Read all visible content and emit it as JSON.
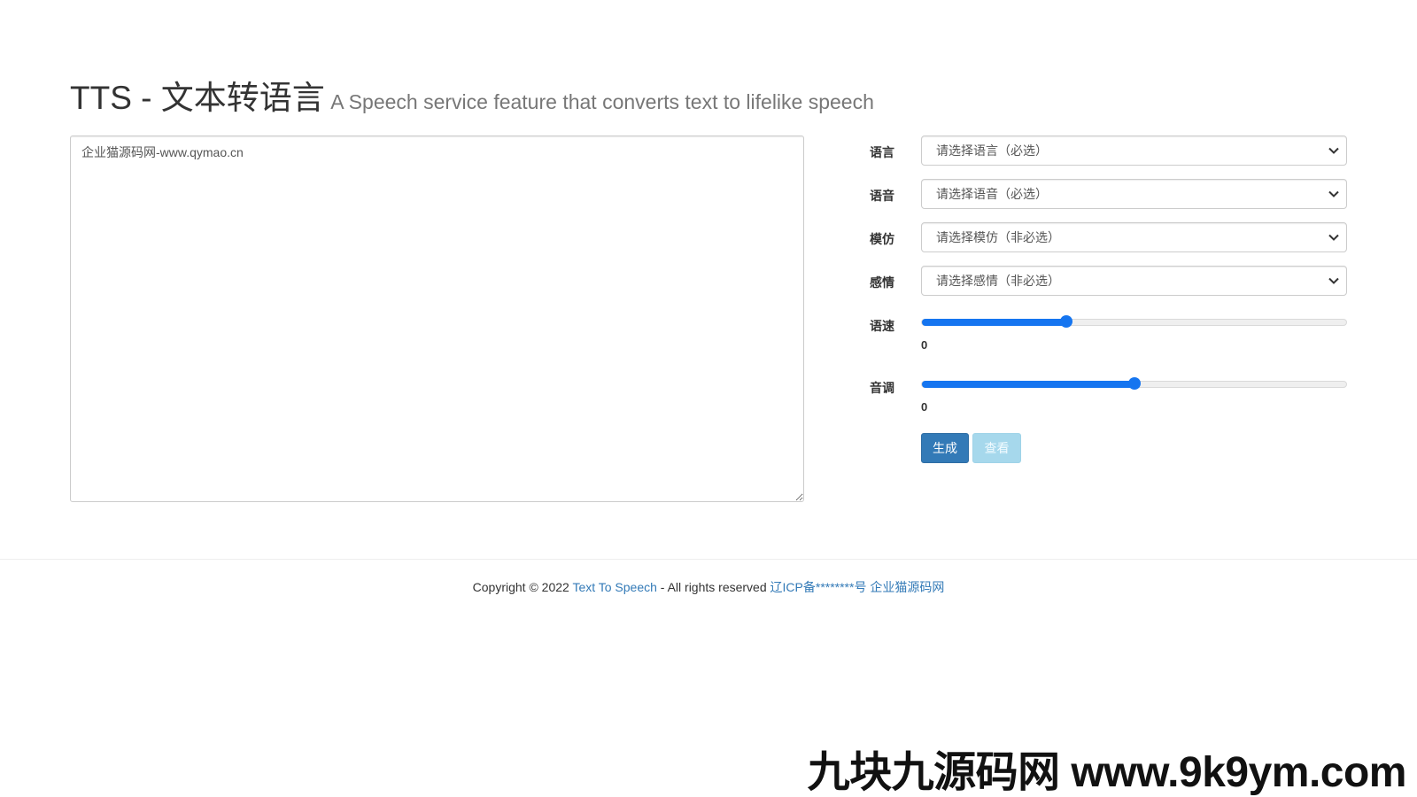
{
  "header": {
    "title": "TTS - 文本转语言",
    "subtitle": "A Speech service feature that converts text to lifelike speech"
  },
  "editor": {
    "text": "企业猫源码网-www.qymao.cn"
  },
  "form": {
    "language": {
      "label": "语言",
      "selected": "请选择语言（必选）"
    },
    "voice": {
      "label": "语音",
      "selected": "请选择语音（必选）"
    },
    "imitation": {
      "label": "模仿",
      "selected": "请选择模仿（非必选）"
    },
    "emotion": {
      "label": "感情",
      "selected": "请选择感情（非必选）"
    },
    "speed": {
      "label": "语速",
      "value": "0",
      "fraction": 0.34
    },
    "pitch": {
      "label": "音调",
      "value": "0",
      "fraction": 0.5
    },
    "generate_label": "生成",
    "view_label": "查看"
  },
  "footer": {
    "prefix": "Copyright © 2022 ",
    "site_link": "Text To Speech",
    "middle": " - All rights reserved ",
    "icp_link": "辽ICP备********号",
    "owner_link": "企业猫源码网"
  },
  "watermark": "九块九源码网 www.9k9ym.com",
  "colors": {
    "primary": "#337ab7",
    "slider": "#1575f0",
    "info_disabled": "#a6d8ec"
  },
  "icons": [
    "chevron-down-icon"
  ]
}
